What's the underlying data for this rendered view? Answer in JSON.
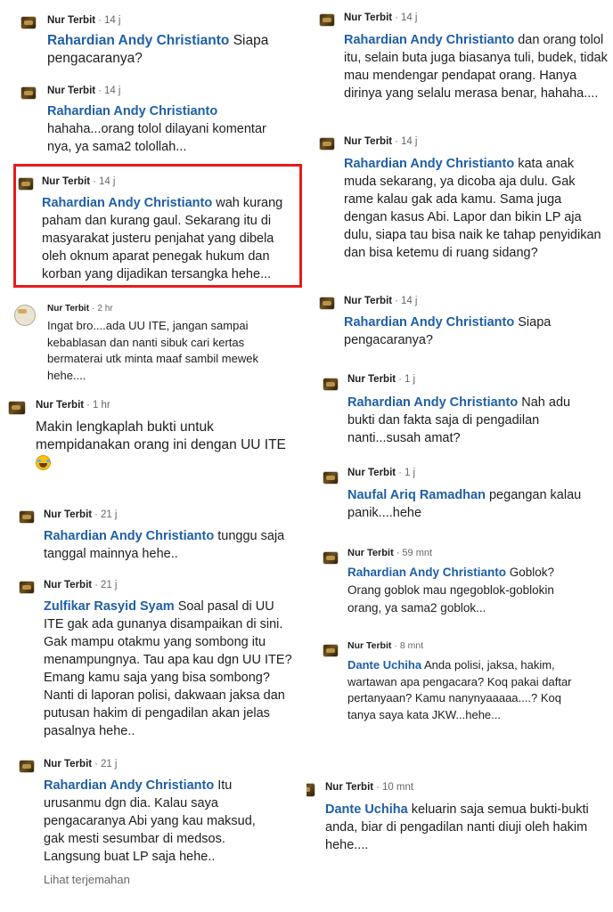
{
  "left": [
    {
      "author": "Nur Terbit",
      "time": "14 j",
      "mention": "Rahardian Andy Christianto",
      "text": " Siapa pengacaranya?"
    },
    {
      "author": "Nur Terbit",
      "time": "14 j",
      "mention": "Rahardian Andy Christianto",
      "text": " hahaha...orang tolol dilayani komentar nya, ya sama2 tolollah..."
    },
    {
      "author": "Nur Terbit",
      "time": "14 j",
      "mention": "Rahardian Andy Christianto",
      "text": " wah kurang paham dan kurang gaul. Sekarang itu di masyarakat justeru penjahat yang dibela oleh oknum aparat penegak hukum dan korban yang dijadikan tersangka hehe..."
    },
    {
      "author": "Nur Terbit",
      "time": "2 hr",
      "mention": "",
      "text": "Ingat bro....ada UU ITE, jangan sampai kebablasan dan nanti sibuk cari kertas bermaterai utk minta maaf sambil mewek hehe...."
    },
    {
      "author": "Nur Terbit",
      "time": "1 hr",
      "mention": "",
      "text": "Makin lengkaplah bukti untuk mempidanakan orang ini dengan UU ITE"
    },
    {
      "author": "Nur Terbit",
      "time": "21 j",
      "mention": "Rahardian Andy Christianto",
      "text": " tunggu saja tanggal mainnya hehe.."
    },
    {
      "author": "Nur Terbit",
      "time": "21 j",
      "mention": "Zulfikar Rasyid Syam",
      "text": " Soal pasal di UU ITE gak ada gunanya disampaikan di sini. Gak mampu otakmu yang sombong itu menampungnya. Tau apa kau dgn UU ITE? Emang kamu saja yang bisa sombong? Nanti di laporan polisi, dakwaan jaksa dan putusan hakim di pengadilan akan jelas pasalnya hehe.."
    },
    {
      "author": "Nur Terbit",
      "time": "21 j",
      "mention": "Rahardian Andy Christianto",
      "text": " Itu urusanmu dgn dia. Kalau saya pengacaranya Abi yang kau maksud, gak mesti sesumbar di medsos. Langsung buat LP saja hehe.."
    }
  ],
  "right": [
    {
      "author": "Nur Terbit",
      "time": "14 j",
      "mention": "Rahardian Andy Christianto",
      "text": " dan orang tolol itu, selain buta juga biasanya tuli, budek, tidak mau mendengar pendapat orang. Hanya dirinya yang selalu merasa benar, hahaha...."
    },
    {
      "author": "Nur Terbit",
      "time": "14 j",
      "mention": "Rahardian Andy Christianto",
      "text": " kata anak muda sekarang, ya dicoba aja dulu. Gak rame kalau gak ada kamu. Sama juga dengan kasus Abi. Lapor dan bikin LP aja dulu, siapa tau bisa naik ke tahap penyidikan dan bisa ketemu di ruang sidang?"
    },
    {
      "author": "Nur Terbit",
      "time": "14 j",
      "mention": "Rahardian Andy Christianto",
      "text": " Siapa pengacaranya?"
    },
    {
      "author": "Nur Terbit",
      "time": "1 j",
      "mention": "Rahardian Andy Christianto",
      "text": " Nah adu bukti dan fakta saja di pengadilan nanti...susah amat?"
    },
    {
      "author": "Nur Terbit",
      "time": "1 j",
      "mention": "Naufal Ariq Ramadhan",
      "text": " pegangan kalau panik....hehe"
    },
    {
      "author": "Nur Terbit",
      "time": "59 mnt",
      "mention": "Rahardian Andy Christianto",
      "text": " Goblok? Orang goblok mau ngegoblok-goblokin orang, ya sama2 goblok..."
    },
    {
      "author": "Nur Terbit",
      "time": "8 mnt",
      "mention": "Dante Uchiha",
      "text": " Anda polisi, jaksa, hakim, wartawan apa pengacara? Koq pakai daftar pertanyaan? Kamu nanynyaaaaa....? Koq tanya saya kata JKW...hehe..."
    },
    {
      "author": "Nur Terbit",
      "time": "10 mnt",
      "mention": "Dante Uchiha",
      "text": " keluarin saja semua bukti-bukti anda, biar di pengadilan nanti diuji oleh hakim hehe...."
    }
  ],
  "see_translation": "Lihat terjemahan",
  "separator": "·",
  "colors": {
    "mention": "#1f5fa8",
    "highlight_border": "#e31c1c",
    "meta": "#65676b"
  }
}
